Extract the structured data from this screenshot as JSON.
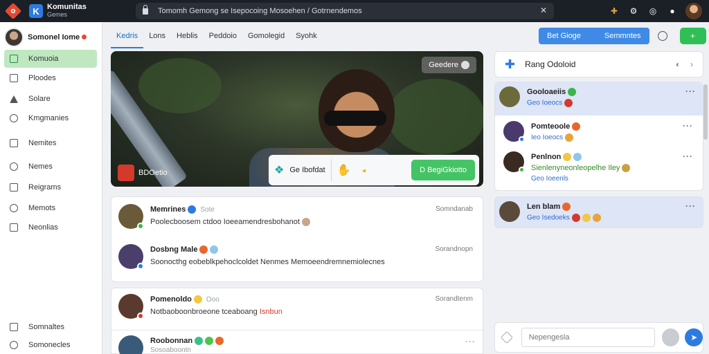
{
  "app": {
    "title": "Komunitas",
    "subtitle": "Gemes"
  },
  "url": "Tomomh Gemong se Isepocoing Mosoehen / Gotrnendemos",
  "profile": {
    "name": "Somonel Iome"
  },
  "sidebar": {
    "items": [
      {
        "label": "Komuoia",
        "icon": "home-icon",
        "active": true
      },
      {
        "label": "Ploodes",
        "icon": "heart-icon"
      },
      {
        "label": "Solare",
        "icon": "triangle-icon"
      },
      {
        "label": "Kmgmanies",
        "icon": "user-icon"
      },
      {
        "label": "Nemites",
        "icon": "bookmark-icon"
      },
      {
        "label": "Nemes",
        "icon": "bell-icon"
      },
      {
        "label": "Reigrams",
        "icon": "book-icon"
      },
      {
        "label": "Memots",
        "icon": "target-icon"
      },
      {
        "label": "Neonlias",
        "icon": "folder-icon"
      }
    ],
    "bottom": [
      {
        "label": "Somnaltes",
        "icon": "calendar-icon"
      },
      {
        "label": "Somonecles",
        "icon": "settings-icon"
      }
    ]
  },
  "tabs": [
    "Kedris",
    "Lons",
    "Heblis",
    "Peddoio",
    "Gomolegid",
    "Syohk"
  ],
  "actions": {
    "primary_left": "Bet Gioge",
    "primary_right": "Semmntes"
  },
  "hero": {
    "chip": "Geedere",
    "tag": "BDOetio",
    "bar_label": "Ge Ibofdat",
    "cta": "D BegiGkiotto"
  },
  "posts": [
    {
      "name": "Memrines",
      "meta": "Sote",
      "text": "Poolecboosem ctdoo Ioeeamendresbohanot",
      "time": "Somndanab",
      "avatar_color": "#6b5a3a",
      "status": "#39b54a"
    },
    {
      "name": "Dosbng Male",
      "meta": "",
      "text": "Soonocthg eobeblkpehoclcoldet Nenmes Memoeendremnemiolecnes",
      "time": "Sorandnopn",
      "avatar_color": "#4a3f6b",
      "status": "#2d7be0"
    },
    {
      "name": "Pomenoldo",
      "meta": "Ooo",
      "text": "Notbaoboonbroeone tceaboang",
      "link": "Isnbun",
      "time": "Sorandtenm",
      "avatar_color": "#5a3a2e",
      "status": "#d33a2c"
    },
    {
      "name": "Roobonnan",
      "meta": "",
      "text": "Sosoaboontn",
      "time": "",
      "avatar_color": "#3a5a7a",
      "status": "#39b54a"
    }
  ],
  "right": {
    "search_label": "Rang Odoloid",
    "messages": [
      {
        "name": "Gooloaeiis",
        "sub": "Geo Ioeocs",
        "highlight": true,
        "avatar_color": "#6b6a3a"
      },
      {
        "name": "Pomteoole",
        "sub": "Ieo Ioeocs",
        "highlight": false,
        "avatar_color": "#4a3a6b"
      },
      {
        "name": "Penlnon",
        "sub": "Geo Ioeenls",
        "msg": "Sienlenyneonleopelhe Iley",
        "highlight": false,
        "avatar_color": "#3a2a22"
      },
      {
        "name": "Len blam",
        "sub": "Geo Isedoeks",
        "highlight": true,
        "avatar_color": "#5a4a3a"
      }
    ]
  },
  "composer": {
    "placeholder": "Nepengesla"
  },
  "colors": {
    "accent": "#2d7be0",
    "success": "#2fbf56",
    "danger": "#d33a2c"
  }
}
